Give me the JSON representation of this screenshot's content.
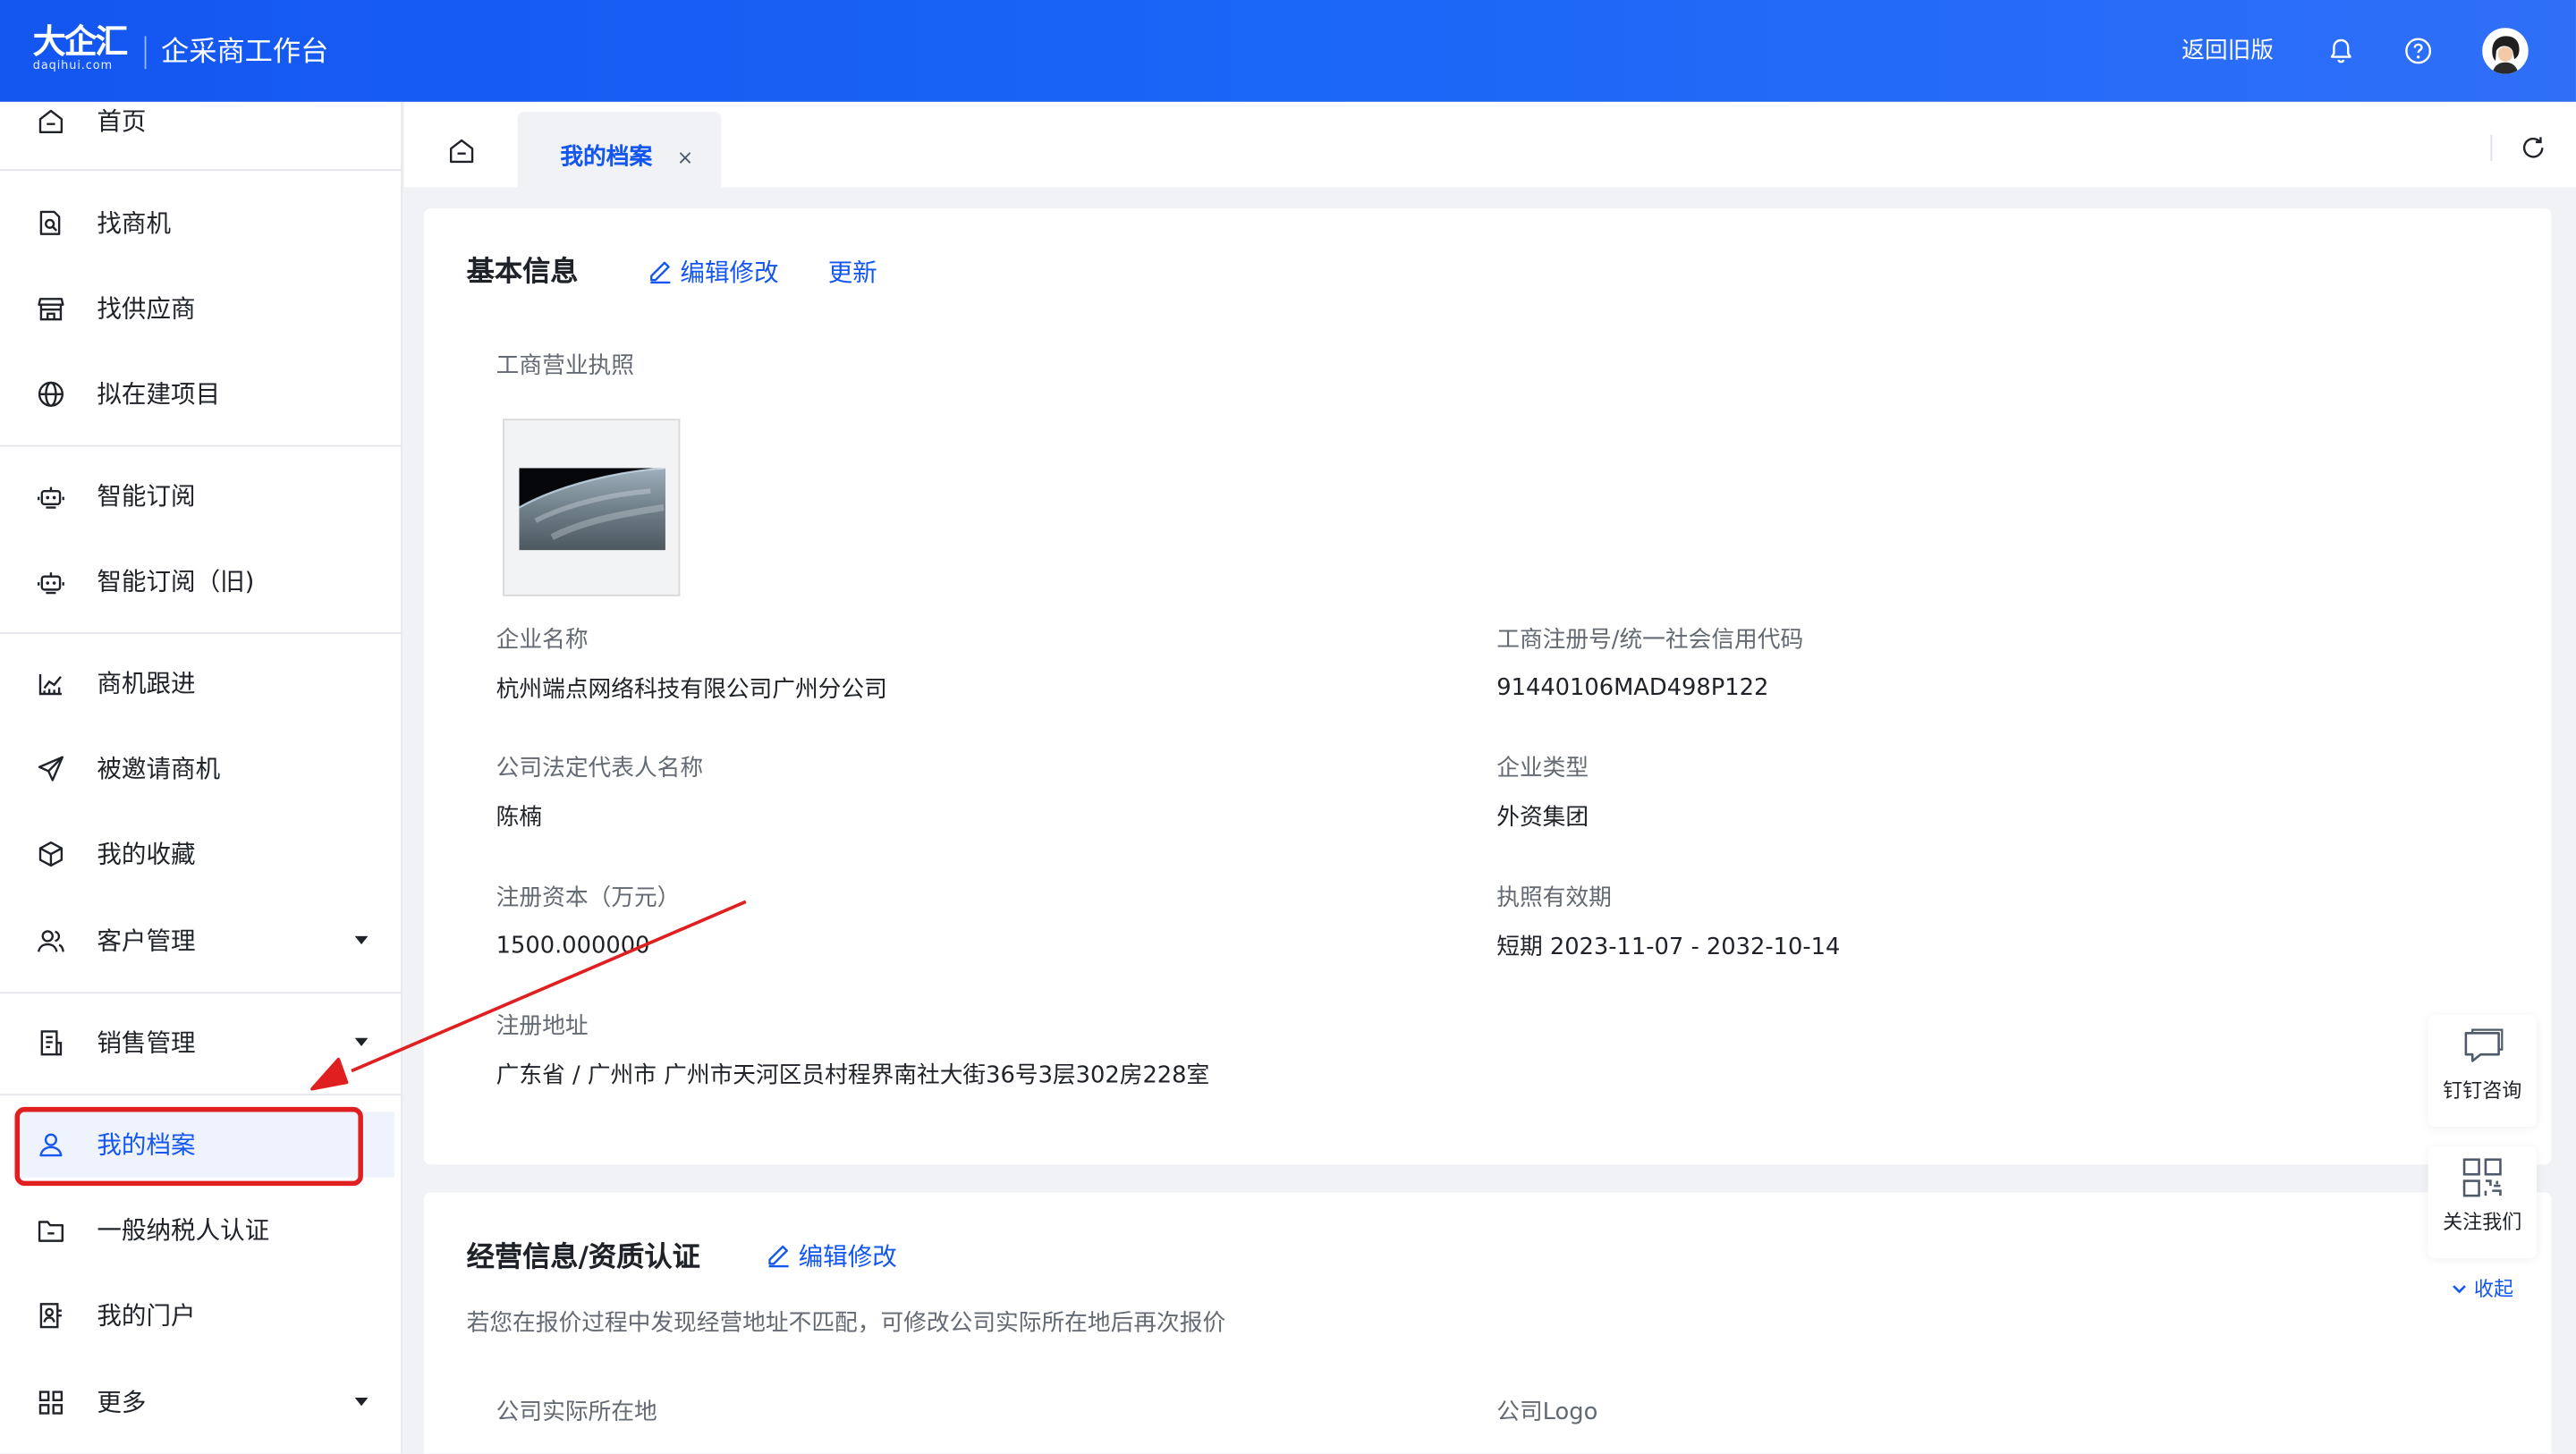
{
  "header": {
    "logo_text": "大企汇",
    "logo_sub": "daqihui.com",
    "app_title": "企采商工作台",
    "back_old": "返回旧版"
  },
  "sidebar": {
    "items": [
      {
        "label": "首页",
        "icon": "home-icon"
      },
      {
        "label": "找商机",
        "icon": "file-search-icon"
      },
      {
        "label": "找供应商",
        "icon": "store-icon"
      },
      {
        "label": "拟在建项目",
        "icon": "globe-icon"
      },
      {
        "label": "智能订阅",
        "icon": "robot-icon"
      },
      {
        "label": "智能订阅（旧)",
        "icon": "robot-icon"
      },
      {
        "label": "商机跟进",
        "icon": "chart-icon"
      },
      {
        "label": "被邀请商机",
        "icon": "send-icon"
      },
      {
        "label": "我的收藏",
        "icon": "box-icon"
      },
      {
        "label": "客户管理",
        "icon": "users-icon"
      },
      {
        "label": "销售管理",
        "icon": "document-icon"
      },
      {
        "label": "我的档案",
        "icon": "user-icon"
      },
      {
        "label": "一般纳税人认证",
        "icon": "folder-icon"
      },
      {
        "label": "我的门户",
        "icon": "portal-icon"
      },
      {
        "label": "更多",
        "icon": "grid-icon"
      }
    ]
  },
  "tabs": {
    "active_label": "我的档案",
    "close": "×"
  },
  "basic": {
    "title": "基本信息",
    "edit": "编辑修改",
    "update": "更新",
    "license_label": "工商营业执照",
    "company_name_label": "企业名称",
    "company_name": "杭州端点网络科技有限公司广州分公司",
    "reg_no_label": "工商注册号/统一社会信用代码",
    "reg_no": "91440106MAD498P122",
    "legal_rep_label": "公司法定代表人名称",
    "legal_rep": "陈楠",
    "type_label": "企业类型",
    "type": "外资集团",
    "capital_label": "注册资本（万元）",
    "capital": "1500.000000",
    "validity_label": "执照有效期",
    "validity": "短期 2023-11-07 - 2032-10-14",
    "address_label": "注册地址",
    "address": "广东省 / 广州市 广州市天河区员村程界南社大街36号3层302房228室"
  },
  "business": {
    "title": "经营信息/资质认证",
    "edit": "编辑修改",
    "note": "若您在报价过程中发现经营地址不匹配，可修改公司实际所在地后再次报价",
    "actual_location_label": "公司实际所在地",
    "logo_label": "公司Logo"
  },
  "float": {
    "dingtalk": "钉钉咨询",
    "follow": "关注我们",
    "collapse": "收起"
  },
  "colors": {
    "primary": "#1456f0",
    "annotation_red": "#e02020"
  }
}
